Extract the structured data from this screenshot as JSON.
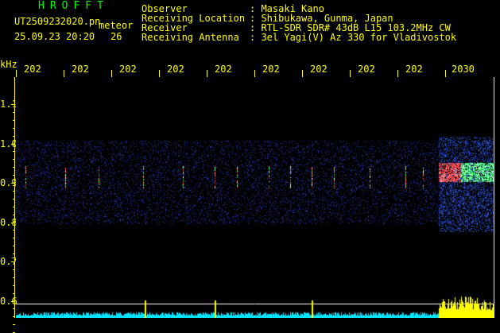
{
  "header": {
    "brand": "HROFFT",
    "filename": "UT2509232020.pn",
    "file_suffix": "meteor",
    "datetime": "25.09.23 20:20",
    "num": "26",
    "fields": [
      {
        "label": "Observer",
        "value": ": Masaki Kano"
      },
      {
        "label": "Receiving Location",
        "value": ": Shibukawa, Gunma, Japan"
      },
      {
        "label": "Receiver",
        "value": ": RTL-SDR SDR# 43dB L15 103.2MHz CW"
      },
      {
        "label": "Receiving Antenna",
        "value": ": 3el Yagi(V) Az 330 for Vladivostok"
      }
    ]
  },
  "axis": {
    "unit": "kHz",
    "x_ticks": [
      "202",
      "202",
      "202",
      "202",
      "202",
      "202",
      "202",
      "202",
      "202",
      "2030"
    ],
    "y_ticks": [
      "1.1",
      "1.0",
      "0.9",
      "0.8",
      "0.7",
      "0.6"
    ]
  },
  "colors": {
    "axis": "#ffff00",
    "text": "#ffff00",
    "brand": "#00ff00",
    "echo_hot": "#ff3333",
    "echo_warm": "#33ff66",
    "noise": "#1e2fb0",
    "signal_band": "#00e5ff"
  }
}
